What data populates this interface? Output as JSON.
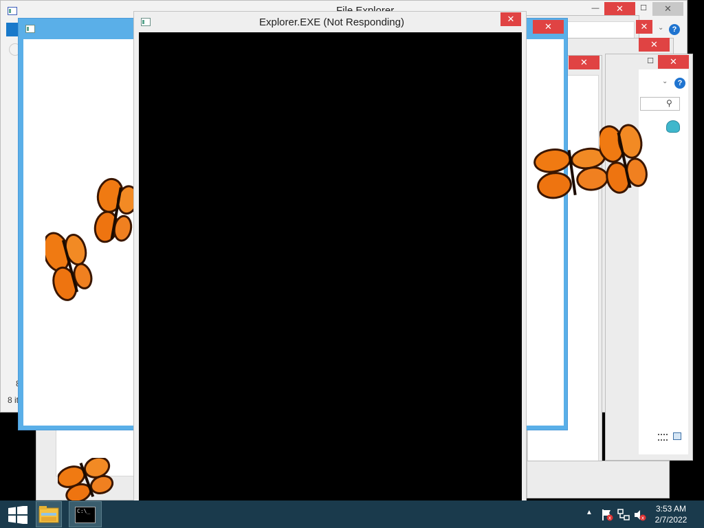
{
  "windows": {
    "file_explorer_title": "File Explorer",
    "front_title": "Explorer.EXE (Not Responding)",
    "close_glyph": "✕",
    "minimize_glyph": "—",
    "maximize_glyph": "☐",
    "status_text": "8 it",
    "status_count": "8"
  },
  "icons": {
    "help": "?",
    "search": "⚲",
    "chevron": "⌄"
  },
  "taskbar": {
    "time": "3:53 AM",
    "date": "2/7/2022",
    "cmd_prompt": "C:\\_"
  },
  "colors": {
    "accent_blue": "#5aafe8",
    "close_red": "#e04343",
    "taskbar": "#1a3a4c",
    "butterfly_orange": "#f07a12"
  }
}
